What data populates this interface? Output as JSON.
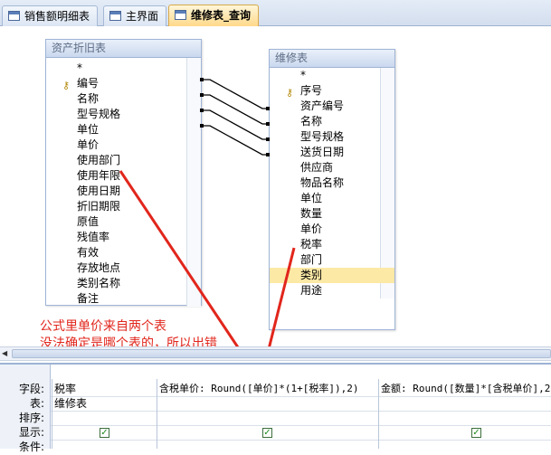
{
  "tabs": [
    {
      "label": "销售额明细表",
      "active": false
    },
    {
      "label": "主界面",
      "active": false
    },
    {
      "label": "维修表_查询",
      "active": true
    }
  ],
  "table_asset": {
    "title": "资产折旧表",
    "fields": [
      "*",
      "编号",
      "名称",
      "型号规格",
      "单位",
      "单价",
      "使用部门",
      "使用年限",
      "使用日期",
      "折旧期限",
      "原值",
      "残值率",
      "有效",
      "存放地点",
      "类别名称",
      "备注"
    ]
  },
  "table_repair": {
    "title": "维修表",
    "fields": [
      "*",
      "序号",
      "资产编号",
      "名称",
      "型号规格",
      "送货日期",
      "供应商",
      "物品名称",
      "单位",
      "数量",
      "单价",
      "税率",
      "部门",
      "类别",
      "用途"
    ],
    "selected": "类别"
  },
  "annotation": {
    "line1": "公式里单价来自两个表",
    "line2": "没法确定是哪个表的，所以出错"
  },
  "grid": {
    "row_labels": [
      "字段:",
      "表:",
      "排序:",
      "显示:",
      "条件:"
    ],
    "columns": [
      {
        "field": "税率",
        "table": "维修表",
        "show": true
      },
      {
        "field": "含税单价: Round([单价]*(1+[税率]),2)",
        "table": "",
        "show": true
      },
      {
        "field": "金额: Round([数量]*[含税单价],2",
        "table": "",
        "show": true
      }
    ]
  },
  "colors": {
    "annotation": "#e1261c",
    "selected_row": "#fce9a6",
    "tab_active": "#ffd98a"
  }
}
